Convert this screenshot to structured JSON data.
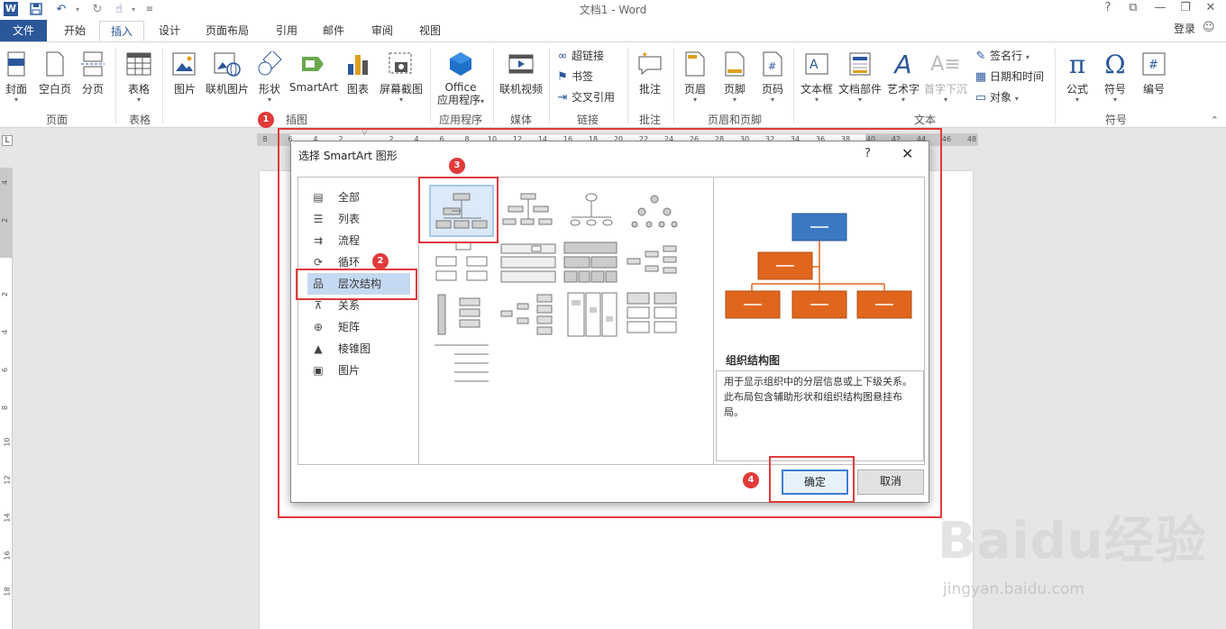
{
  "window": {
    "title": "文档1 - Word",
    "quick_access_icons": [
      "save-icon",
      "undo-icon",
      "redo-icon",
      "touch-mode-icon",
      "customize-icon"
    ],
    "controls": [
      "?",
      "restore",
      "minimize",
      "maximize",
      "close"
    ]
  },
  "tabs": {
    "file": "文件",
    "items": [
      "开始",
      "插入",
      "设计",
      "页面布局",
      "引用",
      "邮件",
      "审阅",
      "视图"
    ],
    "active": "插入",
    "login": "登录"
  },
  "ribbon": {
    "buttons": [
      "封面",
      "空白页",
      "分页",
      "表格",
      "图片",
      "联机图片",
      "形状",
      "SmartArt",
      "图表",
      "屏幕截图",
      "Office",
      "应用程序",
      "联机视频",
      "批注",
      "页眉",
      "页脚",
      "页码",
      "文本框",
      "文档部件",
      "艺术字",
      "首字下沉",
      "公式",
      "符号",
      "编号"
    ],
    "small": [
      "超链接",
      "书签",
      "交叉引用",
      "签名行",
      "日期和时间",
      "对象"
    ],
    "groups": [
      "页面",
      "表格",
      "插图",
      "应用程序",
      "媒体",
      "链接",
      "批注",
      "页眉和页脚",
      "文本",
      "符号"
    ]
  },
  "ruler": {
    "numbers": [
      "8",
      "6",
      "4",
      "2",
      "2",
      "4",
      "6",
      "8",
      "10",
      "12",
      "14",
      "16",
      "18",
      "20",
      "22",
      "24",
      "26",
      "28",
      "30",
      "32",
      "34",
      "36",
      "38",
      "40",
      "42",
      "44",
      "46",
      "48"
    ],
    "left_numbers": [
      "4",
      "2",
      "2",
      "4",
      "6",
      "8",
      "10",
      "12",
      "14",
      "16",
      "18"
    ],
    "corner": "L"
  },
  "dialog": {
    "title": "选择 SmartArt 图形",
    "help": "?",
    "close": "✕",
    "categories": [
      "全部",
      "列表",
      "流程",
      "循环",
      "层次结构",
      "关系",
      "矩阵",
      "棱锥图",
      "图片"
    ],
    "selected_category": "层次结构",
    "preview_title": "组织结构图",
    "preview_desc": "用于显示组织中的分层信息或上下级关系。此布局包含辅助形状和组织结构图悬挂布局。",
    "ok": "确定",
    "cancel": "取消"
  },
  "annotations": [
    "1",
    "2",
    "3",
    "4"
  ],
  "watermark": {
    "main": "Baidu经验",
    "sub": "jingyan.baidu.com"
  },
  "colors": {
    "accent": "#2b579a",
    "annotation": "#e23a3a",
    "org_top": "#3b78c2",
    "org_child": "#e0661e"
  }
}
